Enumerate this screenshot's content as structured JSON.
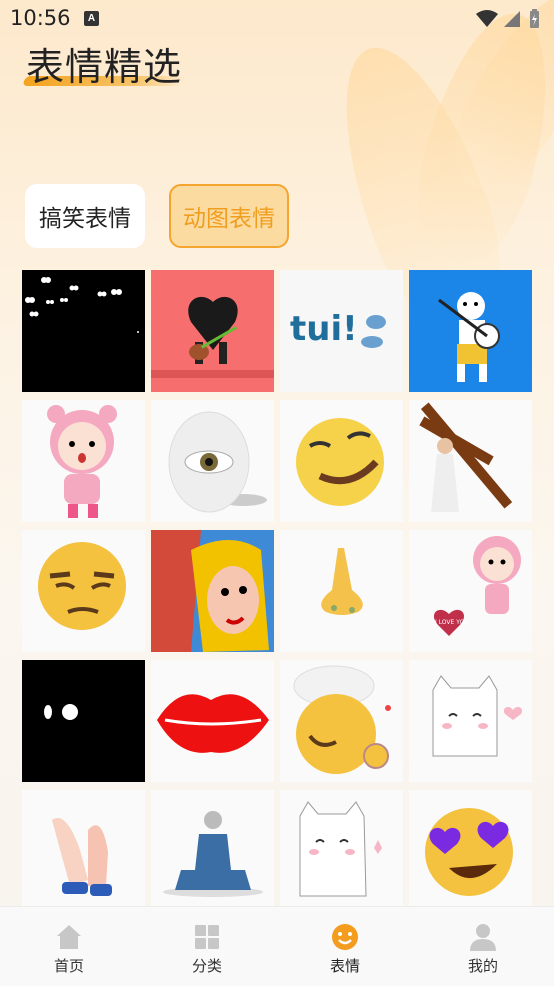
{
  "status_bar": {
    "time": "10:56",
    "notification_icon": "A"
  },
  "header": {
    "title": "表情精选"
  },
  "tabs": [
    {
      "label": "搞笑表情",
      "active": false
    },
    {
      "label": "动图表情",
      "active": true
    }
  ],
  "accent_color": "#f39c1e",
  "grid": {
    "items": [
      {
        "icon": "eyes-in-dark-sticker"
      },
      {
        "icon": "heart-guitar-sticker"
      },
      {
        "icon": "tui-text-sticker",
        "text": "tui!"
      },
      {
        "icon": "banjo-character-sticker"
      },
      {
        "icon": "pink-bear-hood-girl-sticker"
      },
      {
        "icon": "eye-egg-sticker"
      },
      {
        "icon": "smirk-moon-sticker"
      },
      {
        "icon": "cross-carrying-sticker"
      },
      {
        "icon": "unamused-face-emoji"
      },
      {
        "icon": "pop-art-couple-sticker"
      },
      {
        "icon": "nose-sticker"
      },
      {
        "icon": "bear-girl-i-love-you-sticker",
        "text": "I LOVE YOU"
      },
      {
        "icon": "two-eyes-dark-sticker"
      },
      {
        "icon": "red-lips-sticker"
      },
      {
        "icon": "chef-kiss-emoji"
      },
      {
        "icon": "shy-cat-heart-sticker"
      },
      {
        "icon": "clapping-hands-sticker"
      },
      {
        "icon": "meditating-figure-sticker"
      },
      {
        "icon": "cat-sticker"
      },
      {
        "icon": "heart-eyes-emoji"
      }
    ]
  },
  "bottom_nav": [
    {
      "label": "首页",
      "icon": "home-icon",
      "active": false
    },
    {
      "label": "分类",
      "icon": "grid-icon",
      "active": false
    },
    {
      "label": "表情",
      "icon": "smile-icon",
      "active": true
    },
    {
      "label": "我的",
      "icon": "user-icon",
      "active": false
    }
  ]
}
